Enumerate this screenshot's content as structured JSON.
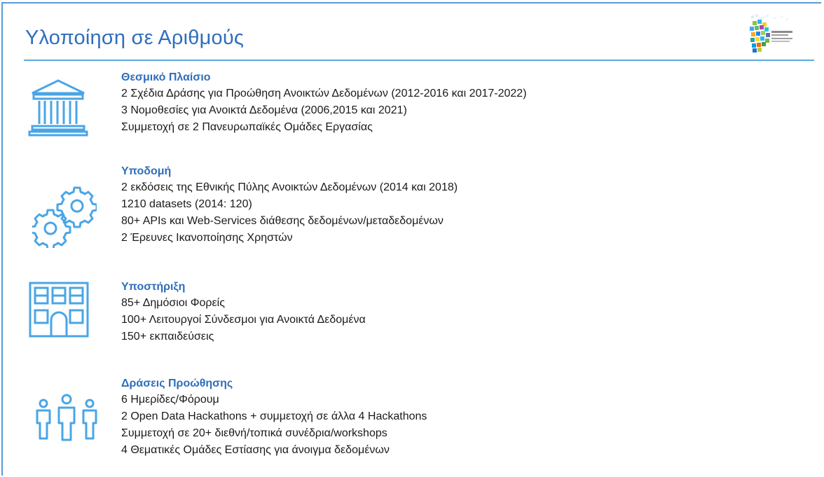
{
  "slide": {
    "title": "Υλοποίηση σε Αριθμούς",
    "accent_color": "#2f6ebd",
    "icon_color": "#4aa5e6"
  },
  "sections": [
    {
      "heading": "Θεσμικό Πλαίσιο",
      "icon": "institution-building-icon",
      "lines": [
        "2 Σχέδια Δράσης για Προώθηση Ανοικτών Δεδομένων (2012-2016 και 2017-2022)",
        "3 Νομοθεσίες για Ανοικτά Δεδομένα (2006,2015 και 2021)",
        "Συμμετοχή σε 2 Πανευρωπαϊκές Ομάδες Εργασίας"
      ]
    },
    {
      "heading": "Υποδομή",
      "icon": "gears-icon",
      "lines": [
        "2 εκδόσεις της Εθνικής Πύλης Ανοικτών Δεδομένων (2014 και 2018)",
        "1210 datasets (2014: 120)",
        "80+ APIs και Web-Services διάθεσης δεδομένων/μεταδεδομένων",
        "2 Έρευνες Ικανοποίησης Χρηστών"
      ]
    },
    {
      "heading": "Υποστήριξη",
      "icon": "office-building-icon",
      "lines": [
        "85+ Δημόσιοι Φορείς",
        "100+ Λειτουργοί Σύνδεσμοι για Ανοικτά Δεδομένα",
        "150+ εκπαιδεύσεις"
      ]
    },
    {
      "heading": "Δράσεις Προώθησης",
      "icon": "people-group-icon",
      "lines": [
        "6 Ημερίδες/Φόρουμ",
        "2 Open Data Hackathons + συμμετοχή σε άλλα 4 Hackathons",
        "Συμμετοχή σε 20+ διεθνή/τοπικά συνέδρια/workshops",
        "4 Θεματικές Ομάδες Εστίασης για άνοιγμα δεδομένων"
      ]
    }
  ]
}
